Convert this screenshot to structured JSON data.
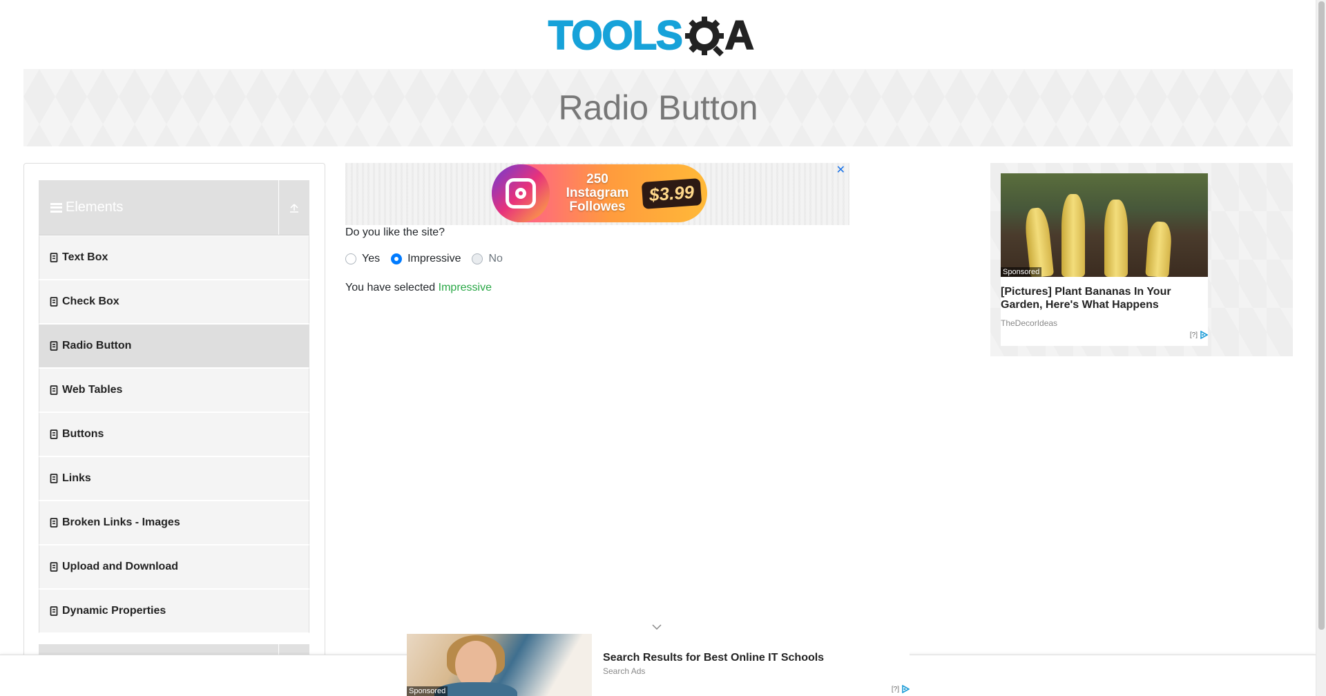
{
  "header": {
    "logo_text_main": "TOOLS",
    "logo_text_suffix": "A",
    "logo_colors": {
      "tools": "#17a2d9",
      "qa": "#222222"
    },
    "page_heading": "Radio Button"
  },
  "sidebar": {
    "group_title": "Elements",
    "group_icon": "menu-icon",
    "collapse_icon": "collapse-up-icon",
    "items": [
      {
        "label": "Text Box",
        "active": false
      },
      {
        "label": "Check Box",
        "active": false
      },
      {
        "label": "Radio Button",
        "active": true
      },
      {
        "label": "Web Tables",
        "active": false
      },
      {
        "label": "Buttons",
        "active": false
      },
      {
        "label": "Links",
        "active": false
      },
      {
        "label": "Broken Links - Images",
        "active": false
      },
      {
        "label": "Upload and Download",
        "active": false
      },
      {
        "label": "Dynamic Properties",
        "active": false
      }
    ]
  },
  "top_ad": {
    "text": "250 Instagram Followes",
    "price": "$3.99",
    "close_label": "✕"
  },
  "main": {
    "question": "Do you like the site?",
    "options": [
      {
        "label": "Yes",
        "checked": false,
        "disabled": false
      },
      {
        "label": "Impressive",
        "checked": true,
        "disabled": false
      },
      {
        "label": "No",
        "checked": false,
        "disabled": true
      }
    ],
    "result_prefix": "You have selected",
    "result_value": "Impressive",
    "accent_color": "#007bff",
    "success_color": "#28a745"
  },
  "right_ad": {
    "sponsored": "Sponsored",
    "headline": "[Pictures] Plant Bananas In Your Garden, Here's What Happens",
    "source": "TheDecorIdeas",
    "adchoice_label": "[?]"
  },
  "bottom_ad": {
    "sponsored": "Sponsored",
    "title": "Search Results for Best Online IT Schools",
    "source": "Search Ads",
    "adchoice_label": "[?]"
  }
}
